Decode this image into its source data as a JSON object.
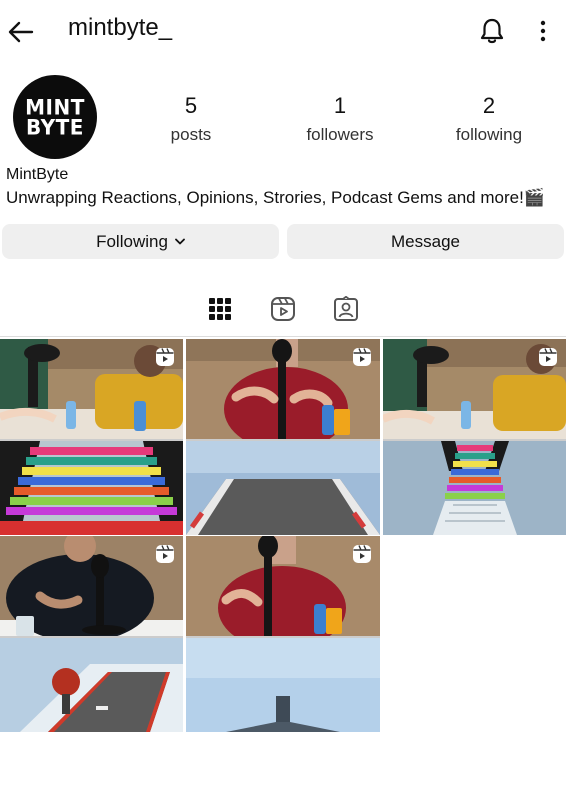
{
  "header": {
    "username": "mintbyte_",
    "icons": {
      "back": "back-arrow-icon",
      "notifications": "bell-icon",
      "more": "more-vertical-icon"
    }
  },
  "profile": {
    "avatar_text": [
      "MINT",
      "BYTE"
    ],
    "stats": {
      "posts": {
        "value": "5",
        "label": "posts"
      },
      "followers": {
        "value": "1",
        "label": "followers"
      },
      "following": {
        "value": "2",
        "label": "following"
      }
    },
    "display_name": "MintByte",
    "bio": "Unwrapping Reactions, Opinions, Strories, Podcast Gems and more!🎬"
  },
  "actions": {
    "following_label": "Following",
    "message_label": "Message"
  },
  "tabs": [
    {
      "name": "posts-grid-icon",
      "active": true
    },
    {
      "name": "reels-icon",
      "active": false
    },
    {
      "name": "tagged-icon",
      "active": false
    }
  ],
  "posts": [
    {
      "kind": "reel",
      "top_scene": "podcast-two-hosts",
      "bottom_scene": "rainbow-ramp"
    },
    {
      "kind": "reel",
      "top_scene": "host-red-shirt",
      "bottom_scene": "sky-runway"
    },
    {
      "kind": "reel",
      "top_scene": "podcast-two-hosts",
      "bottom_scene": "rainbow-ramp-sky"
    },
    {
      "kind": "reel",
      "top_scene": "host-black-shirt",
      "bottom_scene": "race-track"
    },
    {
      "kind": "reel",
      "top_scene": "host-red-shirt",
      "bottom_scene": "sky-ramp"
    }
  ],
  "colors": {
    "button_bg": "#efefef",
    "text": "#111111",
    "divider": "#dcdcdc"
  }
}
